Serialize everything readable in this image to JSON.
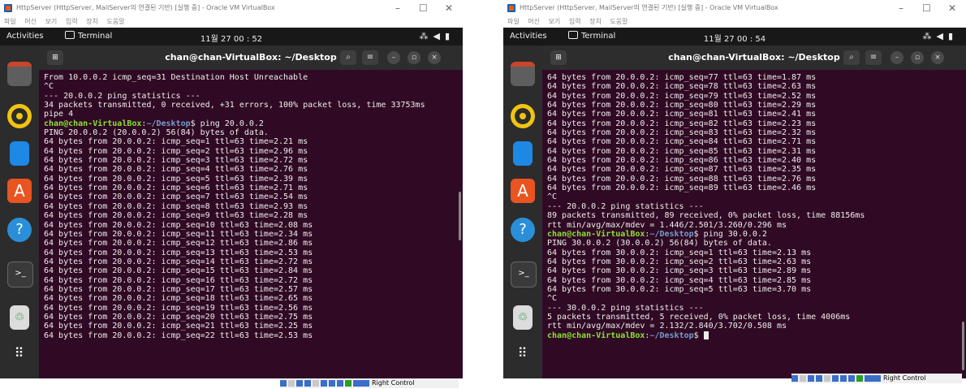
{
  "windows": [
    {
      "vb_title": "HttpServer (HttpServer, MailServer의 연결된 기반) [실행 중] - Oracle VM VirtualBox",
      "vb_menu": [
        "파일",
        "머신",
        "보기",
        "입력",
        "장치",
        "도움말"
      ],
      "activities": "Activities",
      "terminal_indicator": "Terminal",
      "clock": "11월 27 00 : 52",
      "terminal_title": "chan@chan-VirtualBox: ~/Desktop",
      "lines": [
        {
          "text": "From 10.0.0.2 icmp_seq=31 Destination Host Unreachable"
        },
        {
          "text": "^C"
        },
        {
          "text": "--- 20.0.0.2 ping statistics ---"
        },
        {
          "text": "34 packets transmitted, 0 received, +31 errors, 100% packet loss, time 33753ms"
        },
        {
          "text": "pipe 4"
        },
        {
          "prompt_user": "chan@chan-VirtualBox",
          "prompt_path": "~/Desktop",
          "cmd": "$ ping 20.0.0.2"
        },
        {
          "text": "PING 20.0.0.2 (20.0.0.2) 56(84) bytes of data."
        },
        {
          "text": "64 bytes from 20.0.0.2: icmp_seq=1 ttl=63 time=2.21 ms"
        },
        {
          "text": "64 bytes from 20.0.0.2: icmp_seq=2 ttl=63 time=2.96 ms"
        },
        {
          "text": "64 bytes from 20.0.0.2: icmp_seq=3 ttl=63 time=2.72 ms"
        },
        {
          "text": "64 bytes from 20.0.0.2: icmp_seq=4 ttl=63 time=2.76 ms"
        },
        {
          "text": "64 bytes from 20.0.0.2: icmp_seq=5 ttl=63 time=2.39 ms"
        },
        {
          "text": "64 bytes from 20.0.0.2: icmp_seq=6 ttl=63 time=2.71 ms"
        },
        {
          "text": "64 bytes from 20.0.0.2: icmp_seq=7 ttl=63 time=2.54 ms"
        },
        {
          "text": "64 bytes from 20.0.0.2: icmp_seq=8 ttl=63 time=2.93 ms"
        },
        {
          "text": "64 bytes from 20.0.0.2: icmp_seq=9 ttl=63 time=2.28 ms"
        },
        {
          "text": "64 bytes from 20.0.0.2: icmp_seq=10 ttl=63 time=2.08 ms"
        },
        {
          "text": "64 bytes from 20.0.0.2: icmp_seq=11 ttl=63 time=2.34 ms"
        },
        {
          "text": "64 bytes from 20.0.0.2: icmp_seq=12 ttl=63 time=2.86 ms"
        },
        {
          "text": "64 bytes from 20.0.0.2: icmp_seq=13 ttl=63 time=2.53 ms"
        },
        {
          "text": "64 bytes from 20.0.0.2: icmp_seq=14 ttl=63 time=2.72 ms"
        },
        {
          "text": "64 bytes from 20.0.0.2: icmp_seq=15 ttl=63 time=2.84 ms"
        },
        {
          "text": "64 bytes from 20.0.0.2: icmp_seq=16 ttl=63 time=2.72 ms"
        },
        {
          "text": "64 bytes from 20.0.0.2: icmp_seq=17 ttl=63 time=2.57 ms"
        },
        {
          "text": "64 bytes from 20.0.0.2: icmp_seq=18 ttl=63 time=2.65 ms"
        },
        {
          "text": "64 bytes from 20.0.0.2: icmp_seq=19 ttl=63 time=2.56 ms"
        },
        {
          "text": "64 bytes from 20.0.0.2: icmp_seq=20 ttl=63 time=2.75 ms"
        },
        {
          "text": "64 bytes from 20.0.0.2: icmp_seq=21 ttl=63 time=2.25 ms"
        },
        {
          "text": "64 bytes from 20.0.0.2: icmp_seq=22 ttl=63 time=2.53 ms"
        }
      ],
      "status_label": "Right Control"
    },
    {
      "vb_title": "HttpServer (HttpServer, MailServer의 연결된 기반) [실행 중] - Oracle VM VirtualBox",
      "vb_menu": [
        "파일",
        "머신",
        "보기",
        "입력",
        "장치",
        "도움말"
      ],
      "activities": "Activities",
      "terminal_indicator": "Terminal",
      "clock": "11월 27 00 : 54",
      "terminal_title": "chan@chan-VirtualBox: ~/Desktop",
      "lines": [
        {
          "text": "64 bytes from 20.0.0.2: icmp_seq=77 ttl=63 time=1.87 ms"
        },
        {
          "text": "64 bytes from 20.0.0.2: icmp_seq=78 ttl=63 time=2.63 ms"
        },
        {
          "text": "64 bytes from 20.0.0.2: icmp_seq=79 ttl=63 time=2.52 ms"
        },
        {
          "text": "64 bytes from 20.0.0.2: icmp_seq=80 ttl=63 time=2.29 ms"
        },
        {
          "text": "64 bytes from 20.0.0.2: icmp_seq=81 ttl=63 time=2.41 ms"
        },
        {
          "text": "64 bytes from 20.0.0.2: icmp_seq=82 ttl=63 time=2.23 ms"
        },
        {
          "text": "64 bytes from 20.0.0.2: icmp_seq=83 ttl=63 time=2.32 ms"
        },
        {
          "text": "64 bytes from 20.0.0.2: icmp_seq=84 ttl=63 time=2.71 ms"
        },
        {
          "text": "64 bytes from 20.0.0.2: icmp_seq=85 ttl=63 time=2.31 ms"
        },
        {
          "text": "64 bytes from 20.0.0.2: icmp_seq=86 ttl=63 time=2.40 ms"
        },
        {
          "text": "64 bytes from 20.0.0.2: icmp_seq=87 ttl=63 time=2.35 ms"
        },
        {
          "text": "64 bytes from 20.0.0.2: icmp_seq=88 ttl=63 time=2.76 ms"
        },
        {
          "text": "64 bytes from 20.0.0.2: icmp_seq=89 ttl=63 time=2.46 ms"
        },
        {
          "text": "^C"
        },
        {
          "text": "--- 20.0.0.2 ping statistics ---"
        },
        {
          "text": "89 packets transmitted, 89 received, 0% packet loss, time 88156ms"
        },
        {
          "text": "rtt min/avg/max/mdev = 1.446/2.501/3.260/0.296 ms"
        },
        {
          "prompt_user": "chan@chan-VirtualBox",
          "prompt_path": "~/Desktop",
          "cmd": "$ ping 30.0.0.2"
        },
        {
          "text": "PING 30.0.0.2 (30.0.0.2) 56(84) bytes of data."
        },
        {
          "text": "64 bytes from 30.0.0.2: icmp_seq=1 ttl=63 time=2.13 ms"
        },
        {
          "text": "64 bytes from 30.0.0.2: icmp_seq=2 ttl=63 time=2.63 ms"
        },
        {
          "text": "64 bytes from 30.0.0.2: icmp_seq=3 ttl=63 time=2.89 ms"
        },
        {
          "text": "64 bytes from 30.0.0.2: icmp_seq=4 ttl=63 time=2.85 ms"
        },
        {
          "text": "64 bytes from 30.0.0.2: icmp_seq=5 ttl=63 time=3.70 ms"
        },
        {
          "text": "^C"
        },
        {
          "text": "--- 30.0.0.2 ping statistics ---"
        },
        {
          "text": "5 packets transmitted, 5 received, 0% packet loss, time 4006ms"
        },
        {
          "text": "rtt min/avg/max/mdev = 2.132/2.840/3.702/0.508 ms"
        },
        {
          "prompt_user": "chan@chan-VirtualBox",
          "prompt_path": "~/Desktop",
          "cmd": "$ ",
          "cursor": true
        }
      ],
      "status_label": "Right Control"
    }
  ],
  "colors": {
    "terminal_bg": "#300a24",
    "prompt_user": "#8ae234",
    "prompt_path": "#729fcf",
    "dock_bg": "#2c2c2c",
    "topbar_bg": "#181818"
  },
  "dock_icons": [
    "files-icon",
    "rhythmbox-icon",
    "writer-icon",
    "app-center-icon",
    "help-icon",
    "terminal-icon",
    "trash-icon",
    "app-grid-icon"
  ]
}
